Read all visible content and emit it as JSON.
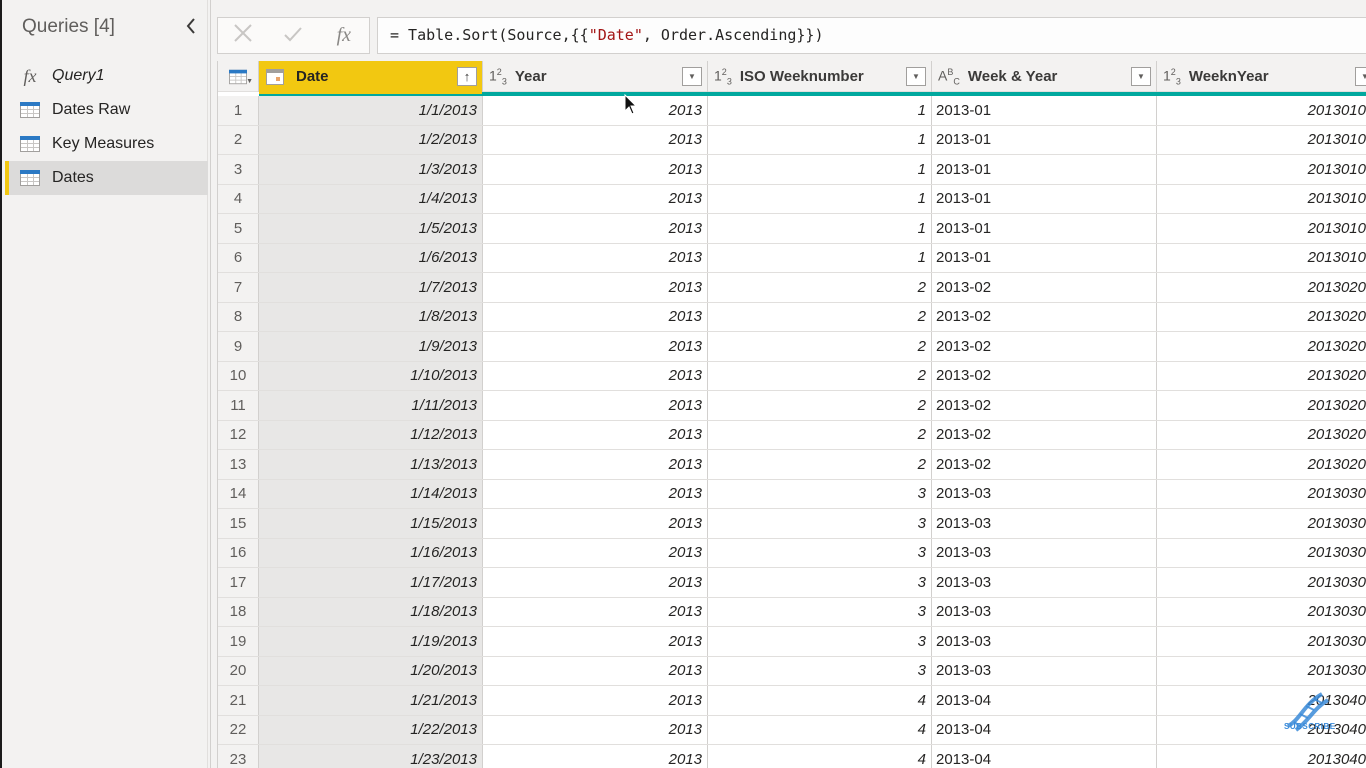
{
  "queries_pane": {
    "title": "Queries [4]",
    "collapse_icon": "chevron-left-icon",
    "items": [
      {
        "label": "Query1",
        "icon": "fx-icon",
        "italic": true,
        "selected": false
      },
      {
        "label": "Dates Raw",
        "icon": "table-icon",
        "italic": false,
        "selected": false
      },
      {
        "label": "Key Measures",
        "icon": "table-icon",
        "italic": false,
        "selected": false
      },
      {
        "label": "Dates",
        "icon": "table-icon",
        "italic": false,
        "selected": true
      }
    ]
  },
  "formula_bar": {
    "cancel_icon": "✕",
    "commit_icon": "✓",
    "fx_label": "fx",
    "prefix": "= Table.Sort(Source,{{",
    "string_literal": "\"Date\"",
    "suffix": ", Order.Ascending}})"
  },
  "grid": {
    "columns": [
      {
        "name": "Date",
        "type_icon": "date-icon",
        "type_label": "",
        "selected": true,
        "sort": "ascending"
      },
      {
        "name": "Year",
        "type_icon": "whole-number-icon",
        "type_label": "123",
        "selected": false
      },
      {
        "name": "ISO Weeknumber",
        "type_icon": "whole-number-icon",
        "type_label": "123",
        "selected": false
      },
      {
        "name": "Week & Year",
        "type_icon": "text-icon",
        "type_label": "ABC",
        "selected": false
      },
      {
        "name": "WeeknYear",
        "type_icon": "whole-number-icon",
        "type_label": "123",
        "selected": false
      }
    ],
    "rows": [
      {
        "n": "1",
        "date": "1/1/2013",
        "year": "2013",
        "iso": "1",
        "wy": "2013-01",
        "wny": "2013010"
      },
      {
        "n": "2",
        "date": "1/2/2013",
        "year": "2013",
        "iso": "1",
        "wy": "2013-01",
        "wny": "2013010"
      },
      {
        "n": "3",
        "date": "1/3/2013",
        "year": "2013",
        "iso": "1",
        "wy": "2013-01",
        "wny": "2013010"
      },
      {
        "n": "4",
        "date": "1/4/2013",
        "year": "2013",
        "iso": "1",
        "wy": "2013-01",
        "wny": "2013010"
      },
      {
        "n": "5",
        "date": "1/5/2013",
        "year": "2013",
        "iso": "1",
        "wy": "2013-01",
        "wny": "2013010"
      },
      {
        "n": "6",
        "date": "1/6/2013",
        "year": "2013",
        "iso": "1",
        "wy": "2013-01",
        "wny": "2013010"
      },
      {
        "n": "7",
        "date": "1/7/2013",
        "year": "2013",
        "iso": "2",
        "wy": "2013-02",
        "wny": "2013020"
      },
      {
        "n": "8",
        "date": "1/8/2013",
        "year": "2013",
        "iso": "2",
        "wy": "2013-02",
        "wny": "2013020"
      },
      {
        "n": "9",
        "date": "1/9/2013",
        "year": "2013",
        "iso": "2",
        "wy": "2013-02",
        "wny": "2013020"
      },
      {
        "n": "10",
        "date": "1/10/2013",
        "year": "2013",
        "iso": "2",
        "wy": "2013-02",
        "wny": "2013020"
      },
      {
        "n": "11",
        "date": "1/11/2013",
        "year": "2013",
        "iso": "2",
        "wy": "2013-02",
        "wny": "2013020"
      },
      {
        "n": "12",
        "date": "1/12/2013",
        "year": "2013",
        "iso": "2",
        "wy": "2013-02",
        "wny": "2013020"
      },
      {
        "n": "13",
        "date": "1/13/2013",
        "year": "2013",
        "iso": "2",
        "wy": "2013-02",
        "wny": "2013020"
      },
      {
        "n": "14",
        "date": "1/14/2013",
        "year": "2013",
        "iso": "3",
        "wy": "2013-03",
        "wny": "2013030"
      },
      {
        "n": "15",
        "date": "1/15/2013",
        "year": "2013",
        "iso": "3",
        "wy": "2013-03",
        "wny": "2013030"
      },
      {
        "n": "16",
        "date": "1/16/2013",
        "year": "2013",
        "iso": "3",
        "wy": "2013-03",
        "wny": "2013030"
      },
      {
        "n": "17",
        "date": "1/17/2013",
        "year": "2013",
        "iso": "3",
        "wy": "2013-03",
        "wny": "2013030"
      },
      {
        "n": "18",
        "date": "1/18/2013",
        "year": "2013",
        "iso": "3",
        "wy": "2013-03",
        "wny": "2013030"
      },
      {
        "n": "19",
        "date": "1/19/2013",
        "year": "2013",
        "iso": "3",
        "wy": "2013-03",
        "wny": "2013030"
      },
      {
        "n": "20",
        "date": "1/20/2013",
        "year": "2013",
        "iso": "3",
        "wy": "2013-03",
        "wny": "2013030"
      },
      {
        "n": "21",
        "date": "1/21/2013",
        "year": "2013",
        "iso": "4",
        "wy": "2013-04",
        "wny": "2013040"
      },
      {
        "n": "22",
        "date": "1/22/2013",
        "year": "2013",
        "iso": "4",
        "wy": "2013-04",
        "wny": "2013040"
      },
      {
        "n": "23",
        "date": "1/23/2013",
        "year": "2013",
        "iso": "4",
        "wy": "2013-04",
        "wny": "2013040"
      }
    ]
  },
  "overlay": {
    "watermark_text": "SUBSCRIBE"
  },
  "colors": {
    "selected_column": "#f2c811",
    "quality_bar": "#01a89e",
    "string_literal": "#a31515",
    "table_icon_header": "#2b79c4"
  }
}
